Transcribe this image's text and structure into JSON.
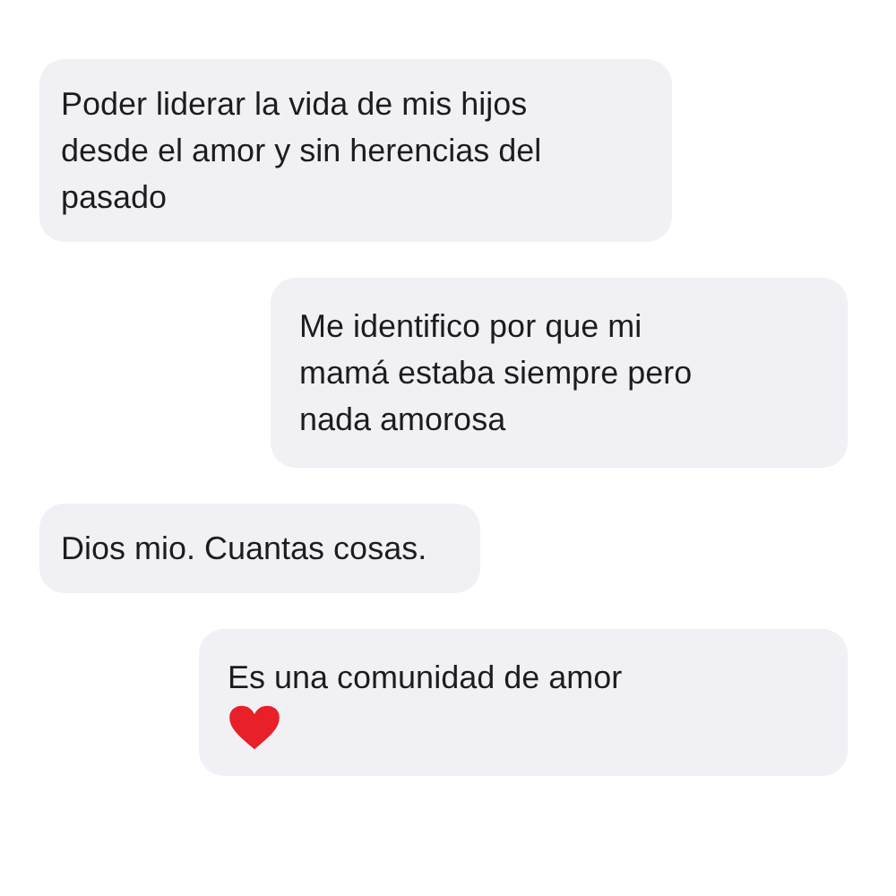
{
  "messages": [
    {
      "kind": "received",
      "text": "Poder liderar la vida de mis hijos desde el amor y sin herencias del pasado"
    },
    {
      "kind": "sent",
      "text": "Me identifico por que mi mamá estaba siempre pero nada amorosa"
    },
    {
      "kind": "received",
      "text": "Dios mio. Cuantas cosas."
    },
    {
      "kind": "sent",
      "text": "Es una comunidad de amor",
      "heart": true
    }
  ]
}
